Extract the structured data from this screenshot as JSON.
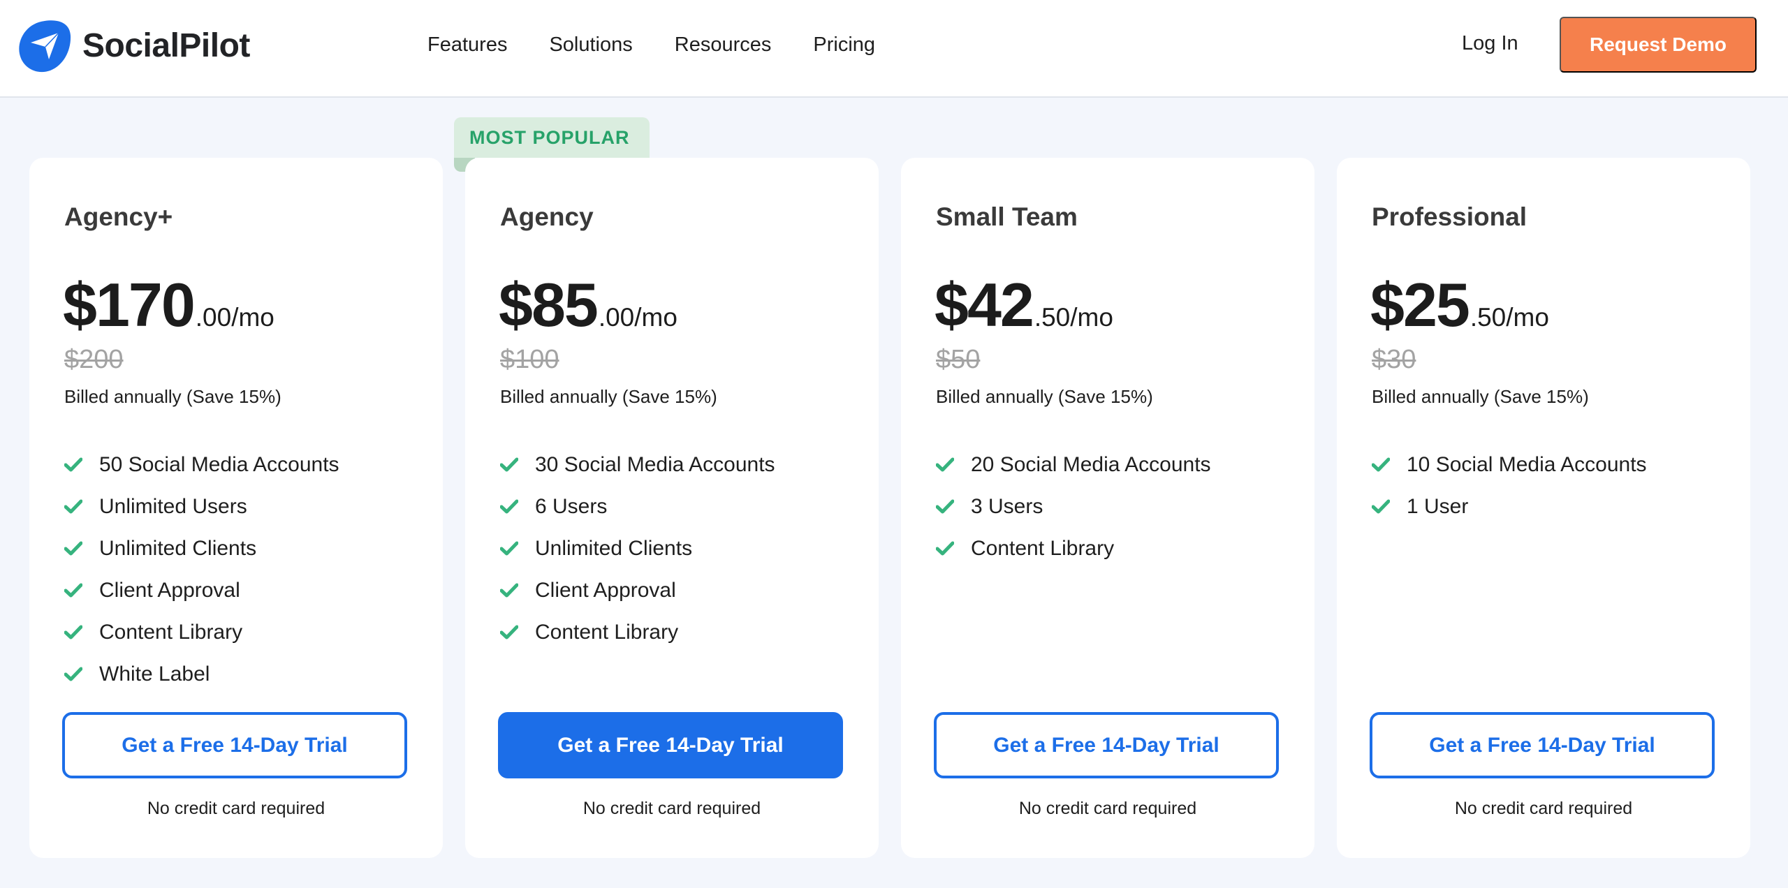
{
  "brand": {
    "name": "SocialPilot",
    "logo_icon": "paper-plane-icon",
    "color": "#1C6EE8"
  },
  "nav": {
    "items": [
      "Features",
      "Solutions",
      "Resources",
      "Pricing"
    ],
    "login_label": "Log In",
    "demo_label": "Request Demo",
    "demo_color": "#F5804C"
  },
  "badge": {
    "label": "MOST POPULAR",
    "color": "#27A269"
  },
  "plans": [
    {
      "name": "Agency+",
      "price_main": "$170",
      "price_suffix": ".00/mo",
      "old_price": "$200",
      "billing": "Billed annually (Save 15%)",
      "features": [
        "50 Social Media Accounts",
        "Unlimited Users",
        "Unlimited Clients",
        "Client Approval",
        "Content Library",
        "White Label"
      ],
      "cta": "Get a Free 14-Day Trial",
      "note": "No credit card required",
      "highlighted": false
    },
    {
      "name": "Agency",
      "price_main": "$85",
      "price_suffix": ".00/mo",
      "old_price": "$100",
      "billing": "Billed annually (Save 15%)",
      "features": [
        "30 Social Media Accounts",
        "6 Users",
        "Unlimited Clients",
        "Client Approval",
        "Content Library"
      ],
      "cta": "Get a Free 14-Day Trial",
      "note": "No credit card required",
      "highlighted": true
    },
    {
      "name": "Small Team",
      "price_main": "$42",
      "price_suffix": ".50/mo",
      "old_price": "$50",
      "billing": "Billed annually (Save 15%)",
      "features": [
        "20 Social Media Accounts",
        "3 Users",
        "Content Library"
      ],
      "cta": "Get a Free 14-Day Trial",
      "note": "No credit card required",
      "highlighted": false
    },
    {
      "name": "Professional",
      "price_main": "$25",
      "price_suffix": ".50/mo",
      "old_price": "$30",
      "billing": "Billed annually (Save 15%)",
      "features": [
        "10 Social Media Accounts",
        "1 User"
      ],
      "cta": "Get a Free 14-Day Trial",
      "note": "No credit card required",
      "highlighted": false
    }
  ],
  "check_icon": "check-icon",
  "check_color": "#36B37E"
}
